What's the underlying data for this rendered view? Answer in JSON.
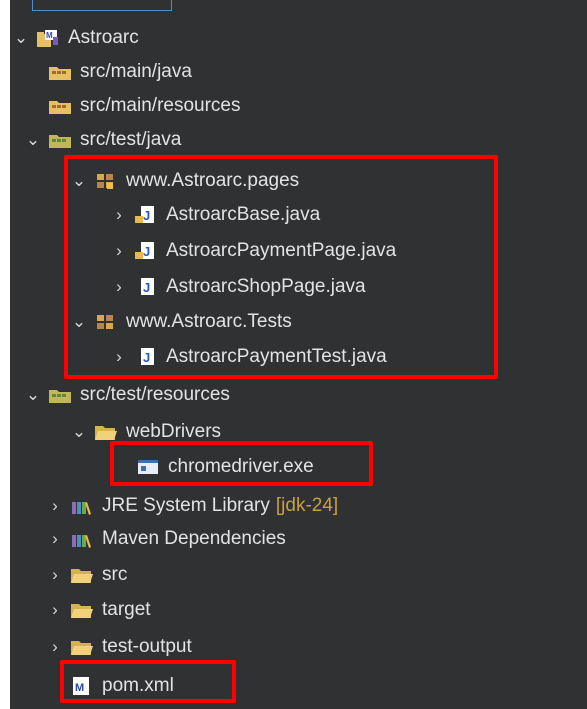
{
  "tree": {
    "project": "Astroarc",
    "items": [
      {
        "id": "src-main-java",
        "label": "src/main/java",
        "icon": "package-folder-icon"
      },
      {
        "id": "src-main-resources",
        "label": "src/main/resources",
        "icon": "package-folder-icon"
      },
      {
        "id": "src-test-java",
        "label": "src/test/java",
        "icon": "package-folder-icon"
      },
      {
        "id": "pkg-pages",
        "label": "www.Astroarc.pages",
        "icon": "package-icon"
      },
      {
        "id": "astroarc-base",
        "label": "AstroarcBase.java",
        "icon": "java-file-icon"
      },
      {
        "id": "astroarc-payment-page",
        "label": "AstroarcPaymentPage.java",
        "icon": "java-file-icon"
      },
      {
        "id": "astroarc-shop-page",
        "label": "AstroarcShopPage.java",
        "icon": "java-file-icon"
      },
      {
        "id": "pkg-tests",
        "label": "www.Astroarc.Tests",
        "icon": "package-icon"
      },
      {
        "id": "astroarc-payment-test",
        "label": "AstroarcPaymentTest.java",
        "icon": "java-file-icon"
      },
      {
        "id": "src-test-resources",
        "label": "src/test/resources",
        "icon": "package-folder-icon"
      },
      {
        "id": "webdrivers",
        "label": "webDrivers",
        "icon": "folder-icon"
      },
      {
        "id": "chromedriver",
        "label": "chromedriver.exe",
        "icon": "exe-file-icon"
      },
      {
        "id": "jre-lib",
        "label": "JRE System Library",
        "decoration": "[jdk-24]",
        "icon": "library-icon"
      },
      {
        "id": "maven-deps",
        "label": "Maven Dependencies",
        "icon": "library-icon"
      },
      {
        "id": "src",
        "label": "src",
        "icon": "folder-icon"
      },
      {
        "id": "target",
        "label": "target",
        "icon": "folder-icon"
      },
      {
        "id": "test-output",
        "label": "test-output",
        "icon": "folder-icon"
      },
      {
        "id": "pom",
        "label": "pom.xml",
        "icon": "maven-file-icon"
      }
    ]
  },
  "colors": {
    "background": "#2f3133",
    "text": "#e3e3e3",
    "highlight": "#ff0000",
    "decoration": "#c8a13e"
  }
}
